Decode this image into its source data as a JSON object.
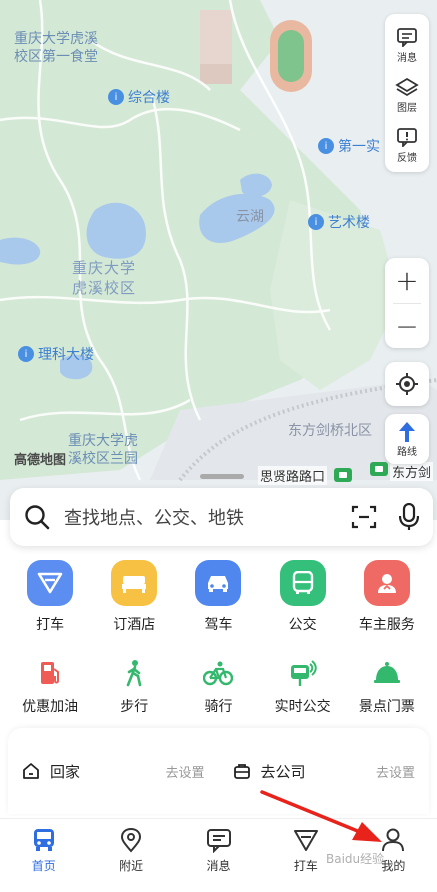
{
  "map": {
    "labels": {
      "campus_canteen": "重庆大学虎溪\n校区第一食堂",
      "campus_name": "重庆大学\n虎溪校区",
      "campus_south": "重庆大学虎\n溪校区兰园",
      "lake": "云湖",
      "dongfang": "东方剑桥北区",
      "street_sixian": "思贤路路口",
      "street_dongfang": "东方剑"
    },
    "pois": {
      "zonghelou": "综合楼",
      "diyi": "第一实",
      "yishu": "艺术楼",
      "like": "理科大楼"
    },
    "logo": "高德地图"
  },
  "side_panel": {
    "messages": "消息",
    "layers": "图层",
    "feedback": "反馈"
  },
  "zoom": {
    "in": "+",
    "out": "−"
  },
  "route": {
    "label": "路线"
  },
  "search": {
    "placeholder": "查找地点、公交、地铁"
  },
  "services": {
    "row1": [
      {
        "label": "打车",
        "color": "#5b8ef0",
        "icon": "taxi-icon"
      },
      {
        "label": "订酒店",
        "color": "#f7c244",
        "icon": "hotel-bed-icon"
      },
      {
        "label": "驾车",
        "color": "#4f87ee",
        "icon": "car-icon"
      },
      {
        "label": "公交",
        "color": "#34c07a",
        "icon": "bus-icon"
      },
      {
        "label": "车主服务",
        "color": "#ef6a64",
        "icon": "driver-service-icon"
      }
    ],
    "row2": [
      {
        "label": "优惠加油",
        "icon": "fuel-pump-icon"
      },
      {
        "label": "步行",
        "icon": "walking-icon"
      },
      {
        "label": "骑行",
        "icon": "bicycle-icon"
      },
      {
        "label": "实时公交",
        "icon": "realtime-bus-icon"
      },
      {
        "label": "景点门票",
        "icon": "ticket-bell-icon"
      }
    ]
  },
  "shortcuts": {
    "home": {
      "title": "回家",
      "action": "去设置"
    },
    "work": {
      "title": "去公司",
      "action": "去设置"
    }
  },
  "tabs": [
    {
      "label": "首页",
      "active": true
    },
    {
      "label": "附近",
      "active": false
    },
    {
      "label": "消息",
      "active": false
    },
    {
      "label": "打车",
      "active": false
    },
    {
      "label": "我的",
      "active": false
    }
  ],
  "watermark": "Baidu经验",
  "colors": {
    "accent": "#2f6ee0",
    "water": "#a9c9ec",
    "green": "#d7ead9",
    "annotation_arrow": "#e8231b"
  }
}
